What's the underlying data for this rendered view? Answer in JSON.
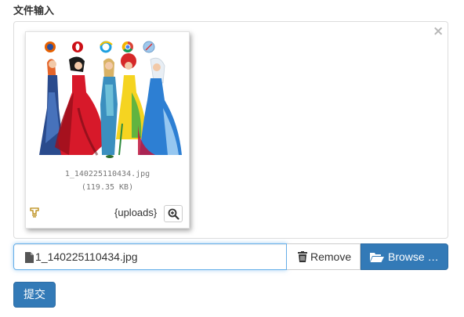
{
  "form": {
    "field_label": "文件输入",
    "submit_label": "提交"
  },
  "preview": {
    "close_icon": "×",
    "file_name": "1_140225110434.jpg",
    "file_size": "(119.35 KB)",
    "uploads_label": "{uploads}",
    "thumbnail_subject": "five women in gowns with browser logos (Firefox, Opera, Internet Explorer, Chrome, Safari)",
    "icons": [
      "drag-handle-icon",
      "zoom-in-icon"
    ]
  },
  "file_input": {
    "caption": "1_140225110434.jpg",
    "remove_label": "Remove",
    "browse_label": "Browse …",
    "icons": [
      "file-icon",
      "trash-icon",
      "folder-open-icon"
    ]
  },
  "colors": {
    "primary": "#337ab7",
    "primary_border": "#2e6da4",
    "focus_border": "#66afe9",
    "box_border": "#dddddd"
  }
}
